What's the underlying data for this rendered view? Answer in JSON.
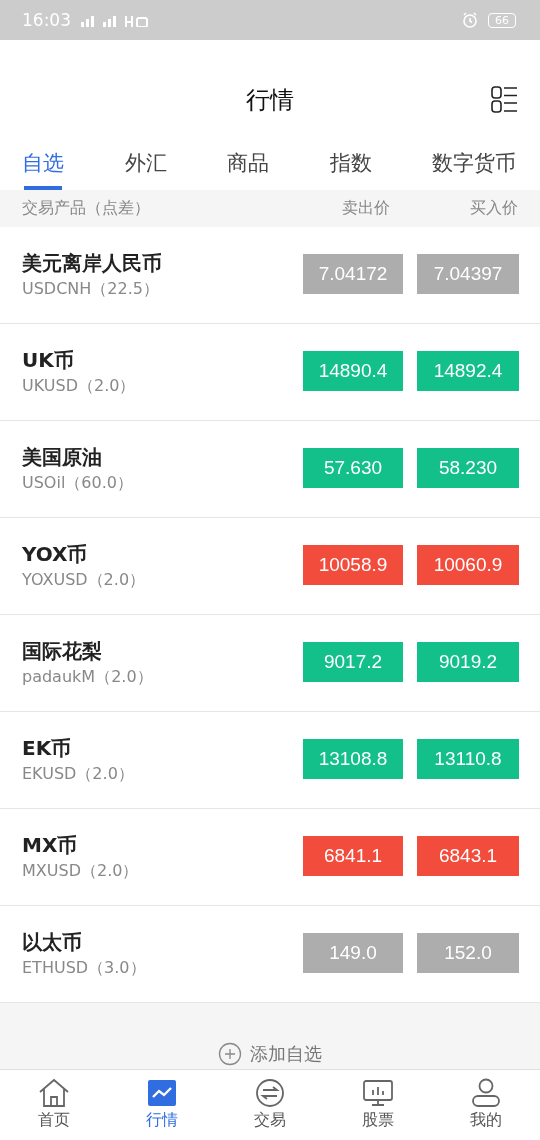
{
  "status_bar": {
    "time": "16:03",
    "battery": "66"
  },
  "header": {
    "title": "行情"
  },
  "tabs": [
    {
      "label": "自选",
      "selected": true
    },
    {
      "label": "外汇",
      "selected": false
    },
    {
      "label": "商品",
      "selected": false
    },
    {
      "label": "指数",
      "selected": false
    },
    {
      "label": "数字货币",
      "selected": false
    }
  ],
  "table": {
    "columns": [
      "交易产品（点差）",
      "卖出价",
      "买入价"
    ],
    "rows": [
      {
        "name": "美元离岸人民币",
        "code": "USDCNH（22.5）",
        "sell": "7.04172",
        "buy": "7.04397",
        "color": "#adadad"
      },
      {
        "name": "UK币",
        "code": "UKUSD（2.0）",
        "sell": "14890.4",
        "buy": "14892.4",
        "color": "#14c08a"
      },
      {
        "name": "美国原油",
        "code": "USOil（60.0）",
        "sell": "57.630",
        "buy": "58.230",
        "color": "#14c08a"
      },
      {
        "name": "YOX币",
        "code": "YOXUSD（2.0）",
        "sell": "10058.9",
        "buy": "10060.9",
        "color": "#f24c3d"
      },
      {
        "name": "国际花梨",
        "code": "padaukM（2.0）",
        "sell": "9017.2",
        "buy": "9019.2",
        "color": "#14c08a"
      },
      {
        "name": "EK币",
        "code": "EKUSD（2.0）",
        "sell": "13108.8",
        "buy": "13110.8",
        "color": "#14c08a"
      },
      {
        "name": "MX币",
        "code": "MXUSD（2.0）",
        "sell": "6841.1",
        "buy": "6843.1",
        "color": "#f24c3d"
      },
      {
        "name": "以太币",
        "code": "ETHUSD（3.0）",
        "sell": "149.0",
        "buy": "152.0",
        "color": "#adadad"
      }
    ]
  },
  "add_button": "添加自选",
  "bottom_nav": [
    {
      "label": "首页",
      "selected": false
    },
    {
      "label": "行情",
      "selected": true
    },
    {
      "label": "交易",
      "selected": false
    },
    {
      "label": "股票",
      "selected": false
    },
    {
      "label": "我的",
      "selected": false
    }
  ]
}
